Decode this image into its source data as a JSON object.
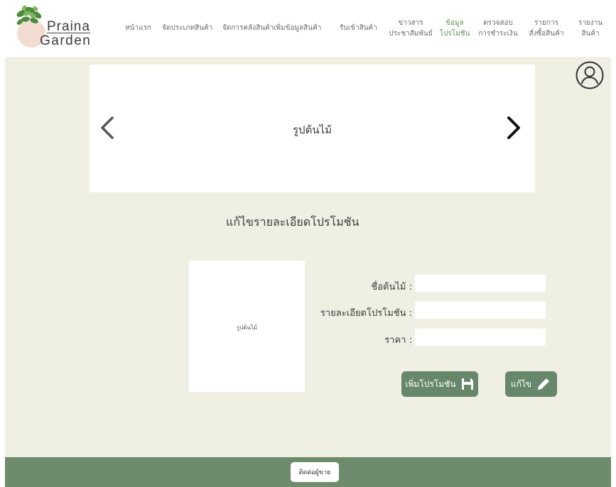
{
  "brand": {
    "name_line1": "Praina",
    "name_line2": "Garden"
  },
  "nav": {
    "items": [
      {
        "line1": "หน้าแรก",
        "line2": ""
      },
      {
        "line1": "จัดประเภทสินค้า",
        "line2": ""
      },
      {
        "line1": "จัดการคลังสินค้า",
        "line2": ""
      },
      {
        "line1": "เพิ่มข้อมูลสินค้า",
        "line2": ""
      },
      {
        "line1": "รับเข้าสินค้า",
        "line2": ""
      },
      {
        "line1": "ข่าวสาร",
        "line2": "ประชาสัมพันธ์"
      },
      {
        "line1": "ข้อมูล",
        "line2": "โปรโมชัน"
      },
      {
        "line1": "ตรวจสอบ",
        "line2": "การชำระเงิน"
      },
      {
        "line1": "รายการ",
        "line2": "สั่งซื้อสินค้า"
      },
      {
        "line1": "รายงาน",
        "line2": "สินค้า"
      }
    ],
    "active_index": 6
  },
  "slider": {
    "label": "รูปต้นไม้",
    "prev_icon": "chevron-left-icon",
    "next_icon": "chevron-right-icon"
  },
  "profile": {
    "icon": "user-circle-icon"
  },
  "form": {
    "title": "แก้ไขรายละเอียดโปรโมชัน",
    "image_label": "รูปต้นไม้",
    "fields": {
      "plant_name": {
        "label": "ชื่อต้นไม้ :",
        "value": ""
      },
      "promo_detail": {
        "label": "รายละเอียดโปรโมชัน :",
        "value": ""
      },
      "price": {
        "label": "ราคา :",
        "value": ""
      }
    },
    "add_button": {
      "label": "เพิ่มโปรโมชัน",
      "icon": "save-icon"
    },
    "edit_button": {
      "label": "แก้ไข",
      "icon": "pencil-icon"
    }
  },
  "footer": {
    "contact_label": "ติดต่อผู้ขาย"
  },
  "colors": {
    "main_bg": "#efefe4",
    "accent_green": "#67876a",
    "footer_green": "#6e8b6c",
    "active_nav": "#5e8f5a",
    "logo_pot": "#f1dcd2"
  }
}
